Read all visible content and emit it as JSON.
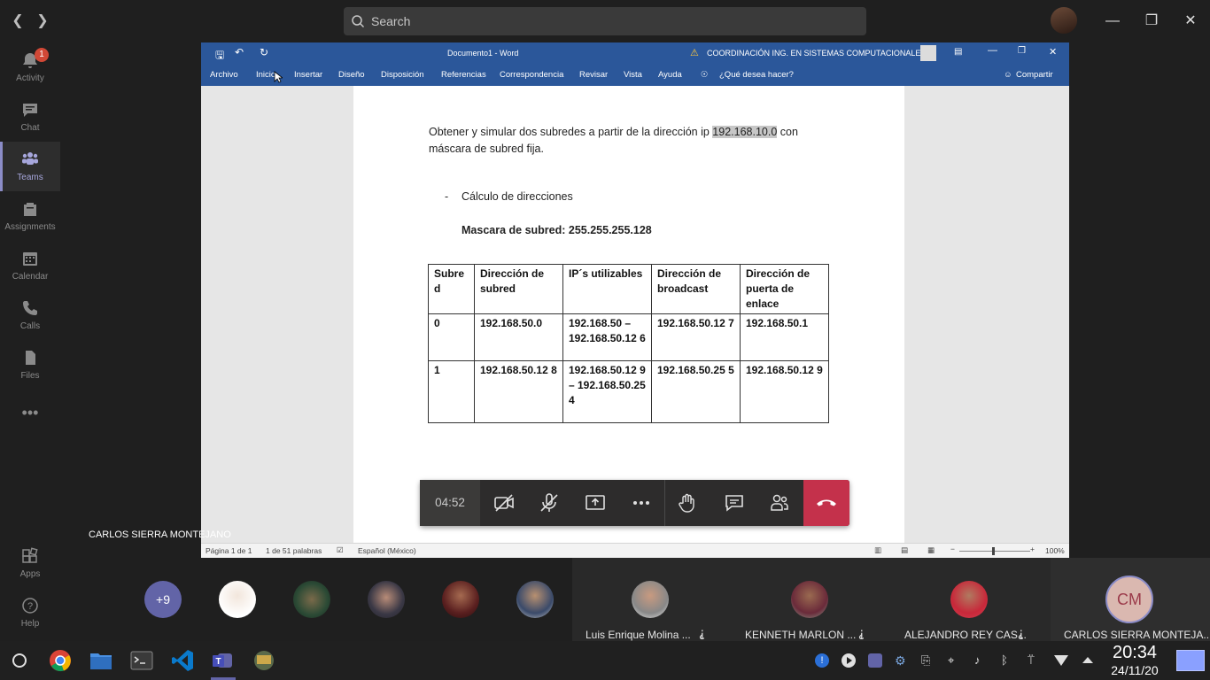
{
  "teams": {
    "search_placeholder": "Search",
    "rail": [
      {
        "label": "Activity",
        "icon": "bell-icon",
        "badge": "1"
      },
      {
        "label": "Chat",
        "icon": "chat-icon"
      },
      {
        "label": "Teams",
        "icon": "teams-icon"
      },
      {
        "label": "Assignments",
        "icon": "assignments-icon"
      },
      {
        "label": "Calendar",
        "icon": "calendar-icon"
      },
      {
        "label": "Calls",
        "icon": "phone-icon"
      },
      {
        "label": "Files",
        "icon": "file-icon"
      },
      {
        "label": "Apps",
        "icon": "apps-icon"
      },
      {
        "label": "Help",
        "icon": "help-icon"
      }
    ],
    "presenter": "CARLOS SIERRA MONTEJANO"
  },
  "word": {
    "title": "Documento1 - Word",
    "org": "COORDINACIÓN ING. EN SISTEMAS COMPUTACIONALES",
    "tabs": [
      "Archivo",
      "Inicio",
      "Insertar",
      "Diseño",
      "Disposición",
      "Referencias",
      "Correspondencia",
      "Revisar",
      "Vista",
      "Ayuda"
    ],
    "tell_me": "¿Qué desea hacer?",
    "share": "Compartir",
    "doc": {
      "para_1a": "Obtener y simular dos subredes a partir de la dirección ip ",
      "para_1_ip": "192.168.10.0",
      "para_1b": " con",
      "para_2": "máscara de subred fija.",
      "bullet": "-",
      "heading": "Cálculo de direcciones",
      "mask": "Mascara de subred: 255.255.255.128",
      "table": {
        "headers": [
          "Subre d",
          "Dirección de subred",
          "IP´s utilizables",
          "Dirección de broadcast",
          "Dirección de puerta de enlace"
        ],
        "rows": [
          [
            "0",
            "192.168.50.0",
            "192.168.50 – 192.168.50.12 6",
            "192.168.50.12 7",
            "192.168.50.1"
          ],
          [
            "1",
            "192.168.50.12 8",
            "192.168.50.12 9 – 192.168.50.25 4",
            "192.168.50.25 5",
            "192.168.50.12 9"
          ]
        ]
      }
    },
    "status": {
      "page": "Página 1 de 1",
      "words": "1 de 51 palabras",
      "lang": "Español (México)",
      "zoom": "100%"
    }
  },
  "call": {
    "timer": "04:52"
  },
  "participants": {
    "more": "+9",
    "tiles": [
      {
        "name": "Luis Enrique Molina ...",
        "muted": true
      },
      {
        "name": "KENNETH MARLON ...",
        "muted": true
      },
      {
        "name": "ALEJANDRO REY CAS...",
        "muted": true
      },
      {
        "name": "CARLOS SIERRA MONTEJA...",
        "initials": "CM"
      }
    ]
  },
  "taskbar": {
    "time": "20:34",
    "date": "24/11/20"
  }
}
